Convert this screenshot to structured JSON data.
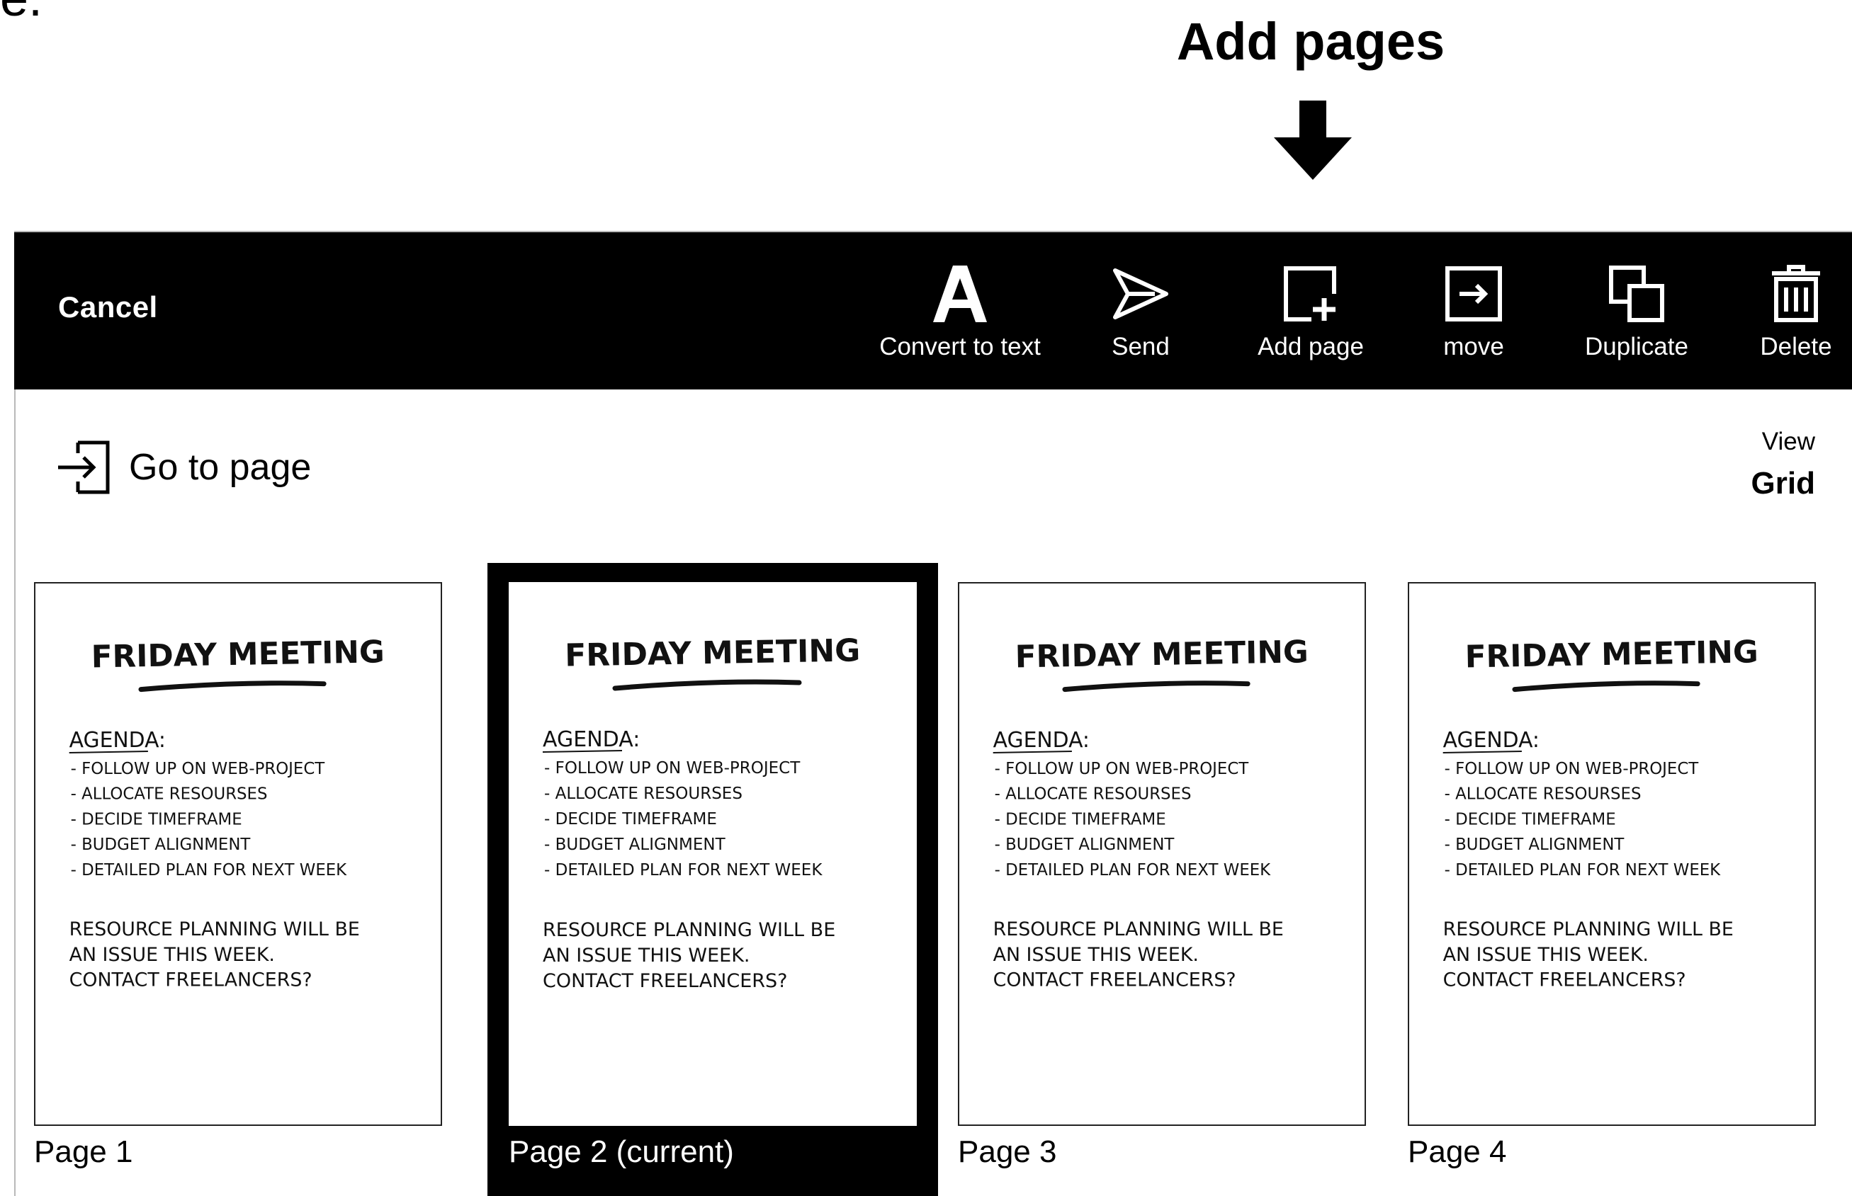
{
  "figure": {
    "letter": "e."
  },
  "callout": {
    "title": "Add pages",
    "arrow_icon": "down-arrow-icon"
  },
  "toolbar": {
    "cancel_label": "Cancel",
    "tools": [
      {
        "label": "Convert to text",
        "icon": "letter-a-icon"
      },
      {
        "label": "Send",
        "icon": "paper-plane-icon"
      },
      {
        "label": "Add page",
        "icon": "add-page-icon"
      },
      {
        "label": "move",
        "icon": "move-arrow-icon"
      },
      {
        "label": "Duplicate",
        "icon": "duplicate-icon"
      },
      {
        "label": "Delete",
        "icon": "trash-icon"
      }
    ]
  },
  "goto": {
    "label": "Go to page",
    "icon": "enter-arrow-icon"
  },
  "view": {
    "label": "View",
    "value": "Grid"
  },
  "pages": [
    {
      "label": "Page 1",
      "current": false
    },
    {
      "label": "Page 2 (current)",
      "current": true
    },
    {
      "label": "Page 3",
      "current": false
    },
    {
      "label": "Page 4",
      "current": false
    }
  ],
  "note": {
    "title": "FRIDAY MEETING",
    "agenda_heading": "AGENDA:",
    "agenda_items": [
      "- FOLLOW UP ON WEB-PROJECT",
      "- ALLOCATE RESOURSES",
      "- DECIDE TIMEFRAME",
      "- BUDGET ALIGNMENT",
      "- DETAILED PLAN FOR NEXT WEEK"
    ],
    "paragraph_lines": [
      "RESOURCE PLANNING WILL BE",
      "AN ISSUE THIS WEEK.",
      "CONTACT FREELANCERS?"
    ]
  }
}
